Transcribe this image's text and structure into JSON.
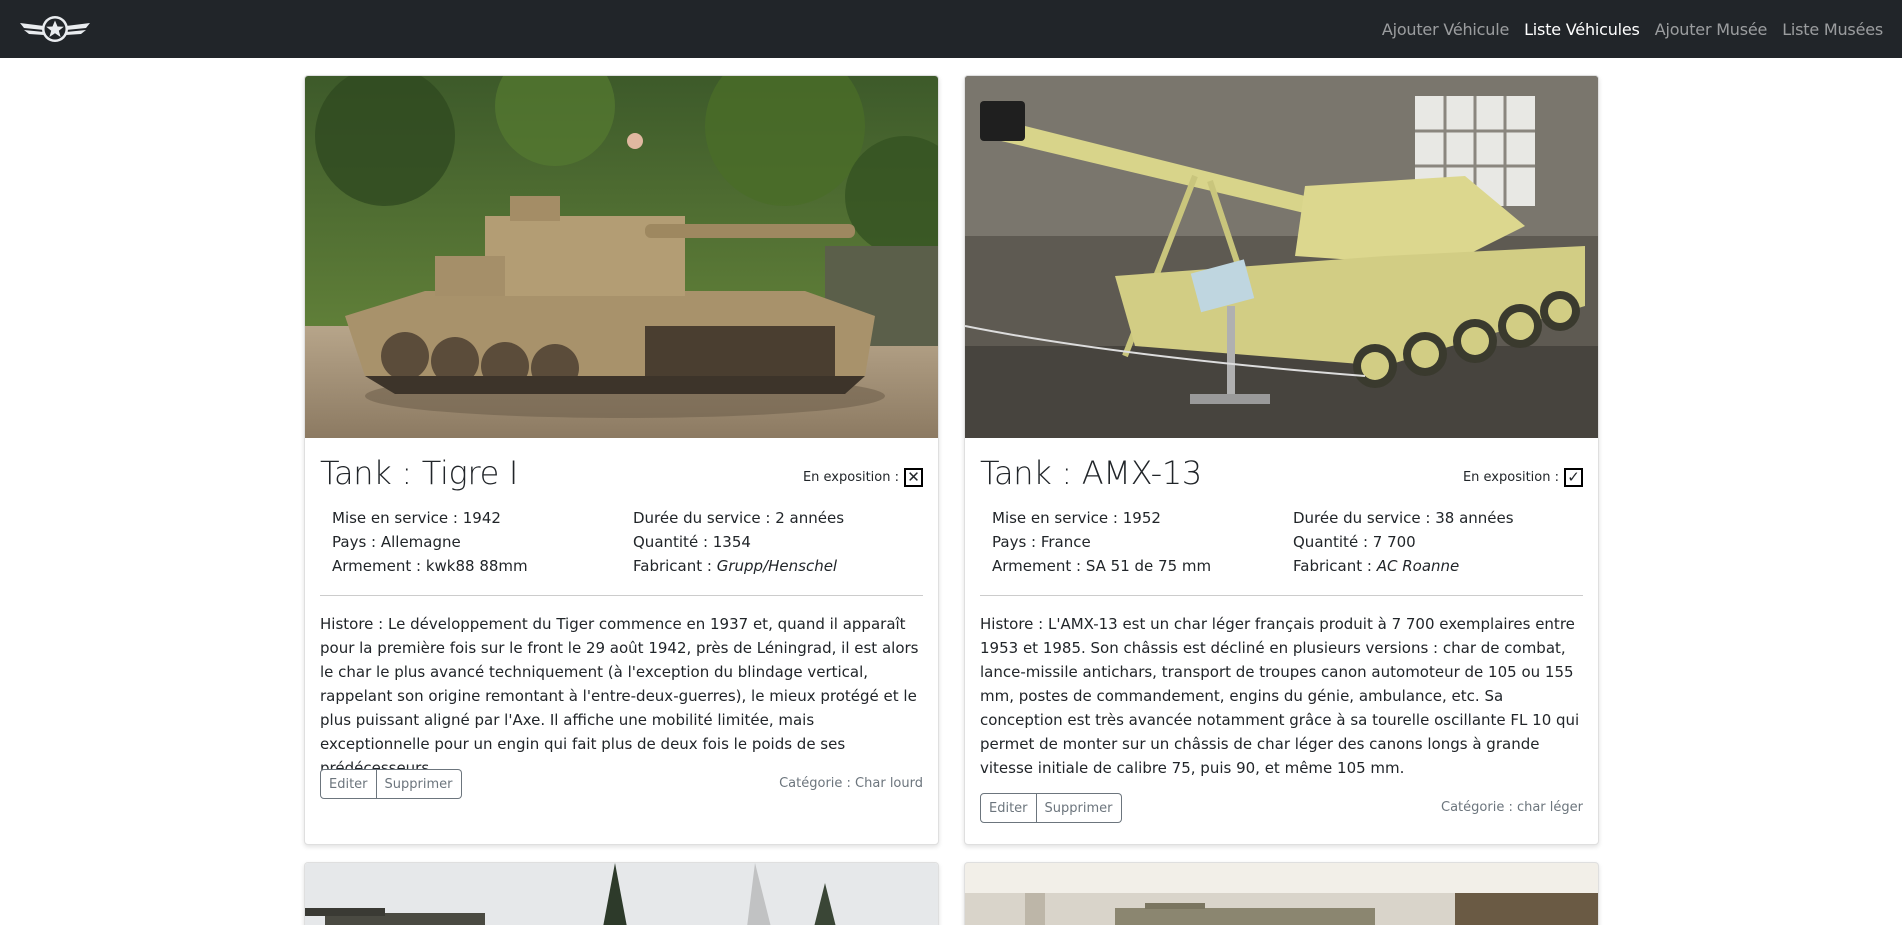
{
  "navbar": {
    "logo": "winged-star-logo",
    "links": [
      {
        "label": "Ajouter Véhicule",
        "active": false
      },
      {
        "label": "Liste Véhicules",
        "active": true
      },
      {
        "label": "Ajouter Musée",
        "active": false
      },
      {
        "label": "Liste Musées",
        "active": false
      }
    ]
  },
  "cards": [
    {
      "title": "Tank : Tigre I",
      "exposition_label": "En exposition :",
      "exposition_state": "✕",
      "mise_en_service": "Mise en service : 1942",
      "duree_service": "Durée du service : 2 années",
      "pays": "Pays : Allemagne",
      "quantite": "Quantité : 1354",
      "armement": "Armement : kwk88 88mm",
      "fabricant_label": "Fabricant : ",
      "fabricant": "Grupp/Henschel",
      "histoire": "Histore : Le développement du Tiger commence en 1937 et, quand il apparaît pour la première fois sur le front le 29 août 1942, près de Léningrad, il est alors le char le plus avancé techniquement (à l'exception du blindage vertical, rappelant son origine remontant à l'entre-deux-guerres), le mieux protégé et le plus puissant aligné par l'Axe. Il affiche une mobilité limitée, mais exceptionnelle pour un engin qui fait plus de deux fois le poids de ses prédécesseurs.",
      "edit_label": "Editer",
      "delete_label": "Supprimer",
      "categorie": "Catégorie : Char lourd"
    },
    {
      "title": "Tank : AMX-13",
      "exposition_label": "En exposition :",
      "exposition_state": "✓",
      "mise_en_service": "Mise en service : 1952",
      "duree_service": "Durée du service : 38 années",
      "pays": "Pays : France",
      "quantite": "Quantité : 7 700",
      "armement": "Armement : SA 51 de 75 mm",
      "fabricant_label": "Fabricant : ",
      "fabricant": "AC Roanne",
      "histoire": "Histore : L'AMX-13 est un char léger français produit à 7 700 exemplaires entre 1953 et 1985. Son châssis est décliné en plusieurs versions : char de combat, lance-missile antichars, transport de troupes canon automoteur de 105 ou 155 mm, postes de commandement, engins du génie, ambulance, etc. Sa conception est très avancée notamment grâce à sa tourelle oscillante FL 10 qui permet de monter sur un châssis de char léger des canons longs à grande vitesse initiale de calibre 75, puis 90, et même 105 mm.",
      "edit_label": "Editer",
      "delete_label": "Supprimer",
      "categorie": "Catégorie : char léger"
    }
  ]
}
